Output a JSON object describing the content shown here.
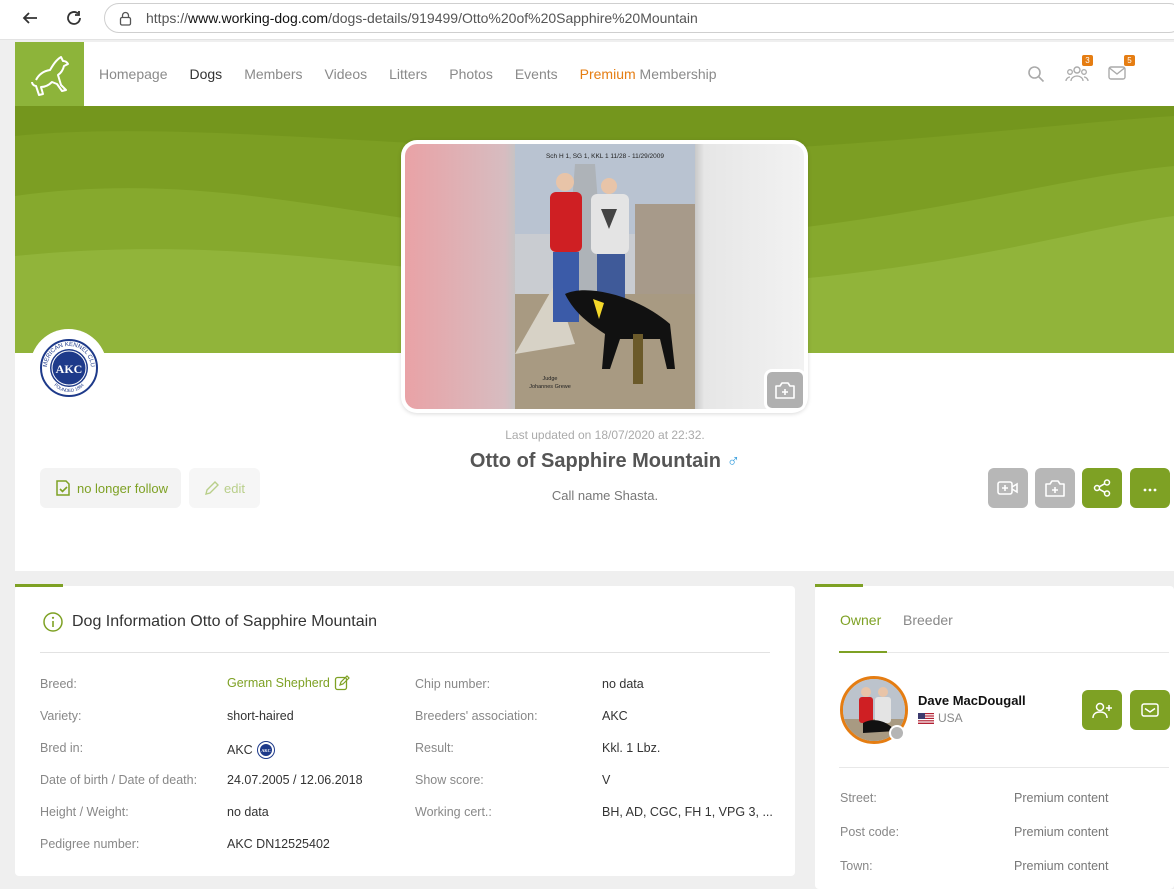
{
  "browser": {
    "url_prefix": "https://",
    "url_host": "www.working-dog.com",
    "url_path": "/dogs-details/919499/Otto%20of%20Sapphire%20Mountain"
  },
  "nav": {
    "items": [
      "Homepage",
      "Dogs",
      "Members",
      "Videos",
      "Litters",
      "Photos",
      "Events"
    ],
    "premium_word": "Premium",
    "membership_word": " Membership",
    "friends_badge": "3",
    "messages_badge": "5"
  },
  "colors": {
    "brand_green": "#7ea124",
    "accent_orange": "#e57d12",
    "male_blue": "#3ba0de"
  },
  "photo": {
    "caption_top": "Sch H 1, SG 1, KKL 1 11/28 - 11/29/2009",
    "caption_judge": "Judge",
    "caption_judge_name": "Johannes Grewe"
  },
  "akc_logo": {
    "ring_text": "AMERICAN KENNEL CLUB",
    "center": "AKC",
    "founded": "FOUNDED 1884"
  },
  "profile": {
    "last_updated": "Last updated on 18/07/2020 at 22:32.",
    "name": "Otto of Sapphire Mountain",
    "sex_symbol": "♂",
    "call_name": "Call name Shasta.",
    "follow_label": "no longer follow",
    "edit_label": "edit"
  },
  "info": {
    "title": "Dog Information Otto of Sapphire Mountain",
    "left": [
      {
        "label": "Breed:",
        "value": "German Shepherd"
      },
      {
        "label": "Variety:",
        "value": "short-haired"
      },
      {
        "label": "Bred in:",
        "value": "AKC"
      },
      {
        "label": "Date of birth / Date of death:",
        "value": "24.07.2005 / 12.06.2018"
      },
      {
        "label": "Height / Weight:",
        "value": "no data"
      },
      {
        "label": "Pedigree number:",
        "value": "AKC DN12525402"
      }
    ],
    "right": [
      {
        "label": "Chip number:",
        "value": "no data"
      },
      {
        "label": "Breeders' association:",
        "value": "AKC"
      },
      {
        "label": "Result:",
        "value": "Kkl. 1 Lbz."
      },
      {
        "label": "Show score:",
        "value": "V"
      },
      {
        "label": "Working cert.:",
        "value": "BH, AD, CGC, FH 1, VPG 3, ..."
      }
    ]
  },
  "owner": {
    "tabs": [
      "Owner",
      "Breeder"
    ],
    "name": "Dave MacDougall",
    "country": "USA",
    "fields": [
      {
        "label": "Street:",
        "value": "Premium content"
      },
      {
        "label": "Post code:",
        "value": "Premium content"
      },
      {
        "label": "Town:",
        "value": "Premium content"
      }
    ]
  }
}
